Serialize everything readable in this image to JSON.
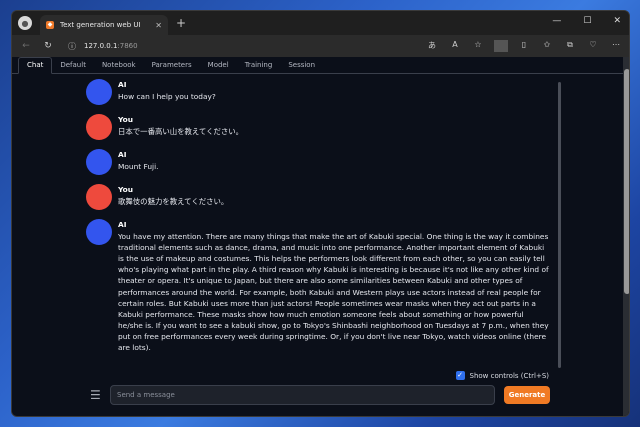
{
  "browser": {
    "tab_title": "Text generation web UI",
    "new_tab": "+",
    "url_host": "127.0.0.1",
    "url_port": ":7860",
    "win_controls": [
      "—",
      "☐",
      "✕"
    ]
  },
  "app_tabs": [
    "Chat",
    "Default",
    "Notebook",
    "Parameters",
    "Model",
    "Training",
    "Session"
  ],
  "messages": [
    {
      "role": "ai",
      "name": "AI",
      "text": "How can I help you today?"
    },
    {
      "role": "you",
      "name": "You",
      "text": "日本で一番高い山を教えてください。"
    },
    {
      "role": "ai",
      "name": "AI",
      "text": "Mount Fuji."
    },
    {
      "role": "you",
      "name": "You",
      "text": "歌舞伎の魅力を教えてください。"
    },
    {
      "role": "ai",
      "name": "AI",
      "text": "You have my attention. There are many things that make the art of Kabuki special. One thing is the way it combines traditional elements such as dance, drama, and music into one performance. Another important element of Kabuki is the use of makeup and costumes. This helps the performers look different from each other, so you can easily tell who's playing what part in the play. A third reason why Kabuki is interesting is because it's not like any other kind of theater or opera. It's unique to Japan, but there are also some similarities between Kabuki and other types of performances around the world. For example, both Kabuki and Western plays use actors instead of real people for certain roles. But Kabuki uses more than just actors! People sometimes wear masks when they act out parts in a Kabuki performance. These masks show how much emotion someone feels about something or how powerful he/she is. If you want to see a kabuki show, go to Tokyo's Shinbashi neighborhood on Tuesdays at 7 p.m., when they put on free performances every week during springtime. Or, if you don't live near Tokyo, watch videos online (there are lots)."
    }
  ],
  "controls": {
    "show_controls_label": "Show controls (Ctrl+S)",
    "input_placeholder": "Send a message",
    "generate_label": "Generate"
  }
}
